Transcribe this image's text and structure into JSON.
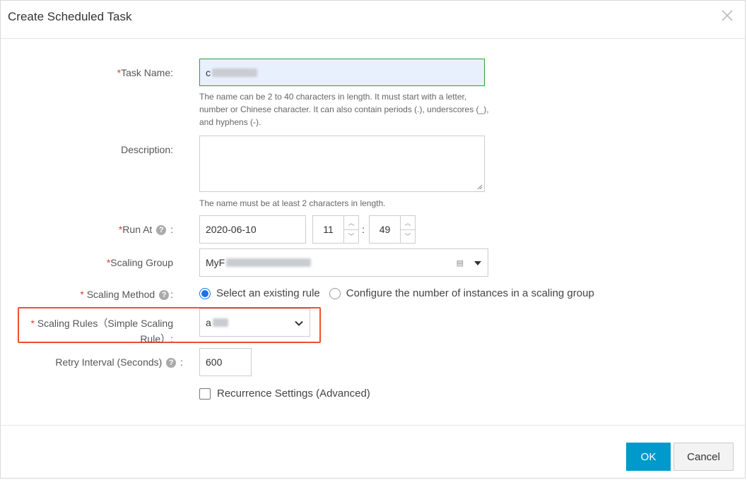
{
  "dialog": {
    "title": "Create Scheduled Task",
    "close_icon": "close-icon"
  },
  "form": {
    "task_name": {
      "required_mark": "*",
      "label": "Task Name:",
      "value": "c",
      "hint": "The name can be 2 to 40 characters in length. It must start with a letter, number or Chinese character. It can also contain periods (.), underscores (_), and hyphens (-)."
    },
    "description": {
      "label": "Description:",
      "value": "",
      "hint": "The name must be at least 2 characters in length."
    },
    "run_at": {
      "required_mark": "*",
      "label": "Run At",
      "help": "?",
      "suffix": ":",
      "date": "2020-06-10",
      "hour": "11",
      "minute": "49",
      "separator": ":"
    },
    "scaling_group": {
      "required_mark": "*",
      "label": "Scaling Group",
      "value": "MyF"
    },
    "scaling_method": {
      "required_mark": "*",
      "label": " Scaling Method",
      "help": "?",
      "suffix": ":",
      "options": [
        {
          "label": "Select an existing rule",
          "checked": true
        },
        {
          "label": "Configure the number of instances in a scaling group",
          "checked": false
        }
      ]
    },
    "scaling_rules": {
      "required_mark": "*",
      "label_line1": " Scaling Rules（Simple Scaling",
      "label_line2": "Rule）:",
      "value": "a"
    },
    "retry_interval": {
      "label": "Retry Interval (Seconds)",
      "help": "?",
      "suffix": ":",
      "value": "600"
    },
    "recurrence": {
      "label": "Recurrence Settings (Advanced)",
      "checked": false
    }
  },
  "footer": {
    "ok_label": "OK",
    "cancel_label": "Cancel"
  },
  "colors": {
    "accent": "#0099cc",
    "highlight_border": "#e8532f",
    "required": "#e4393c",
    "focus_border": "#2e9c3f"
  }
}
